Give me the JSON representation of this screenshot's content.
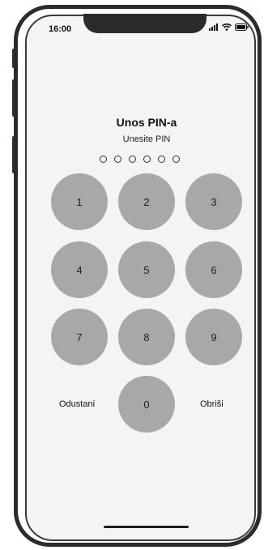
{
  "status_bar": {
    "time": "16:00",
    "icons": [
      "signal-icon",
      "wifi-icon",
      "battery-icon"
    ]
  },
  "pin_screen": {
    "title": "Unos PIN-a",
    "subtitle": "Unesite PIN",
    "pin_length": 6,
    "digits_entered": 0,
    "keys": [
      "1",
      "2",
      "3",
      "4",
      "5",
      "6",
      "7",
      "8",
      "9",
      "0"
    ],
    "cancel_label": "Odustani",
    "delete_label": "Obriši"
  },
  "colors": {
    "key_fill": "#a8a8a8",
    "screen_background": "#f4f4f4",
    "frame": "#2b2b2b"
  }
}
